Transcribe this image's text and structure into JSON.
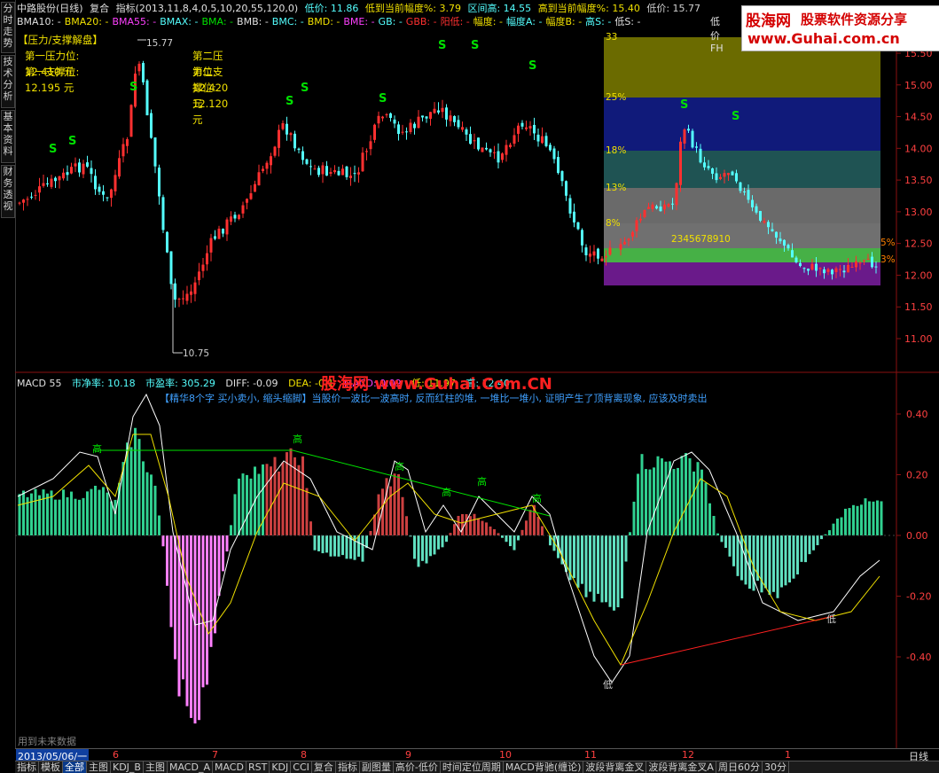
{
  "header": {
    "stock": "中路股份(日线)",
    "mode": "复合",
    "indicator": "指标(2013,11,8,4,0,5,10,20,55,120,0)",
    "low_label": "低价: 11.86",
    "low_to_now": "低到当前幅度%: 3.79",
    "range_high": "区间高: 14.55",
    "high_to_now": "高到当前幅度%: 15.40",
    "low_price": "低价: 15.77"
  },
  "ma_row": [
    "BMA10: -",
    "BMA20: -",
    "BMA55: -",
    "BMAX: -",
    "BMA: -",
    "BMB: -",
    "BMC: -",
    "BMD: -",
    "BME: -",
    "GB: -",
    "GBB: -",
    "阳低: -",
    "幅度: -",
    "幅度A: -",
    "幅度B: -",
    "高S: -",
    "低S: -"
  ],
  "ma_row_right": "低价FH",
  "support": {
    "title": "【压力/支撑解盘】",
    "r1": "第一压力位: 12.410 元",
    "r2": "第二压力位: 12.420 元",
    "s1": "第一支撑位: 12.195 元",
    "s2": "第二支撑位: 12.120 元"
  },
  "logo": {
    "brand": "股海网",
    "slogan": "股票软件资源分享",
    "url": "www.Guhai.com.cn"
  },
  "left_tabs": [
    "分时走势",
    "技术分析",
    "基本资料",
    "财务透视"
  ],
  "price_axis": [
    "15.50",
    "15.00",
    "14.50",
    "14.00",
    "13.50",
    "13.00",
    "12.50",
    "12.00",
    "11.50",
    "11.00"
  ],
  "annotations": {
    "high": "15.77",
    "low": "10.75"
  },
  "inset_levels": [
    "33",
    "25%",
    "18%",
    "13%",
    "8%",
    "5%",
    "3%"
  ],
  "inset_digits": "2345678910",
  "macd": {
    "name": "MACD 55",
    "pb": "市净率: 10.18",
    "pe": "市盈率: 305.29",
    "diff": "DIFF: -0.09",
    "dea": "DEA: -0.1",
    "macd": "MACD: 0.09",
    "low": "低: 11.97",
    "high": "高: 12.40",
    "note": "【精华8个字 买小卖小, 缩头缩脚】当股价一波比一波高时, 反而红柱的堆, 一堆比一堆小, 证明产生了顶背离现象, 应该及时卖出",
    "axis": [
      "0.40",
      "0.20",
      "0.00",
      "-0.20",
      "-0.40"
    ],
    "marks": {
      "high": "高",
      "low": "低"
    }
  },
  "watermark": "股海网 www.Guhai.Com.CN",
  "future_note": "用到未来数据",
  "date_row": {
    "selected": "2013/05/06/一",
    "months": [
      "6",
      "7",
      "8",
      "9",
      "10",
      "11",
      "12",
      "1"
    ],
    "period": "日线"
  },
  "tabs": [
    "指标",
    "模板",
    "全部",
    "主图",
    "KDJ_B",
    "主图",
    "MACD_A",
    "MACD",
    "RST",
    "KDJ",
    "CCI",
    "复合",
    "指标",
    "副图量",
    "高价-低价",
    "时间定位周期",
    "MACD背驰(缠论)",
    "波段背离金叉",
    "波段背离金叉A",
    "周日60分",
    "30分"
  ],
  "colors": {
    "up": "#ff3030",
    "down": "#54ffff",
    "yellow": "#f0e000",
    "green": "#00e000",
    "axis": "#c8c8c8"
  }
}
